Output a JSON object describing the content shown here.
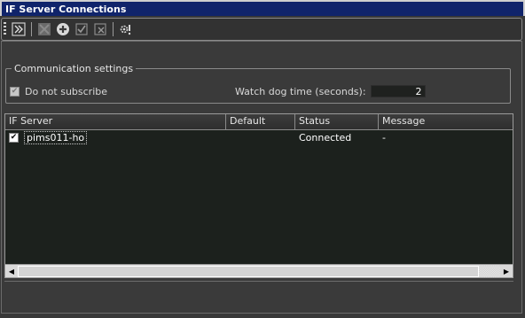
{
  "window": {
    "title": "IF Server Connections"
  },
  "toolbar": {
    "buttons": [
      {
        "icon": "connect-icon",
        "enabled": true
      },
      {
        "icon": "delete-icon",
        "enabled": false
      },
      {
        "icon": "add-icon",
        "enabled": true
      },
      {
        "icon": "check-all-icon",
        "enabled": false
      },
      {
        "icon": "uncheck-all-icon",
        "enabled": false
      },
      {
        "icon": "settings-icon",
        "enabled": true
      }
    ]
  },
  "communication": {
    "legend": "Communication settings",
    "do_not_subscribe_label": "Do not subscribe",
    "do_not_subscribe_checked": true,
    "watchdog_label": "Watch dog time (seconds):",
    "watchdog_value": "2"
  },
  "grid": {
    "columns": [
      "IF Server",
      "Default",
      "Status",
      "Message"
    ],
    "rows": [
      {
        "checked": true,
        "server": "pims011-ho",
        "default": "",
        "status": "Connected",
        "message": "-"
      }
    ]
  },
  "colors": {
    "title_bar": "#10246b",
    "grid_background": "#1c211d",
    "panel_background": "#3a3a3a"
  }
}
